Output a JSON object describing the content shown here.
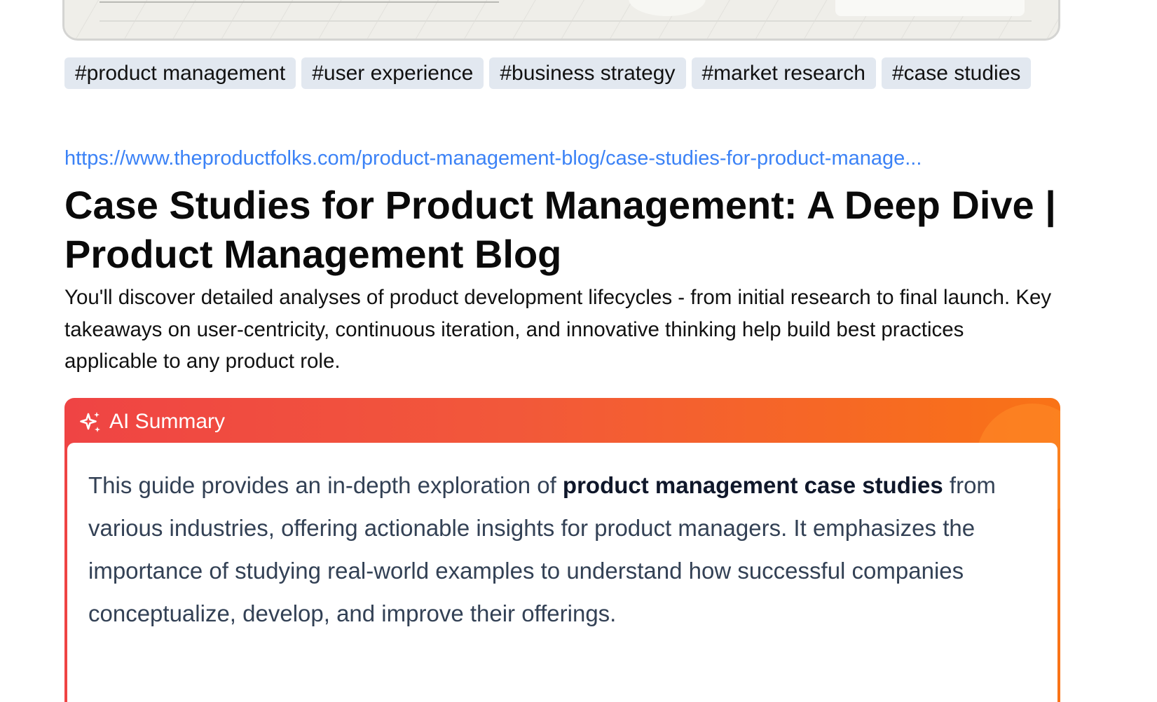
{
  "tags": [
    "#product management",
    "#user experience",
    "#business strategy",
    "#market research",
    "#case studies"
  ],
  "source_url": "https://www.theproductfolks.com/product-management-blog/case-studies-for-product-manage...",
  "article": {
    "title": "Case Studies for Product Management: A Deep Dive | Product Management Blog",
    "description": "You'll discover detailed analyses of product development lifecycles - from initial research to final launch. Key takeaways on user-centricity, continuous iteration, and innovative thinking help build best practices applicable to any product role."
  },
  "ai_summary": {
    "label": "AI Summary",
    "icon": "sparkle-icon",
    "text_before": "This guide provides an in-depth exploration of ",
    "text_bold": "product management case studies",
    "text_after": " from various industries, offering actionable insights for product managers. It emphasizes the importance of studying real-world examples to understand how successful companies conceptualize, develop, and improve their offerings."
  },
  "colors": {
    "tag_bg": "#e2e8f0",
    "link": "#3b82f6",
    "summary_gradient_start": "#ef4444",
    "summary_gradient_end": "#f97316",
    "summary_text": "#334155"
  }
}
